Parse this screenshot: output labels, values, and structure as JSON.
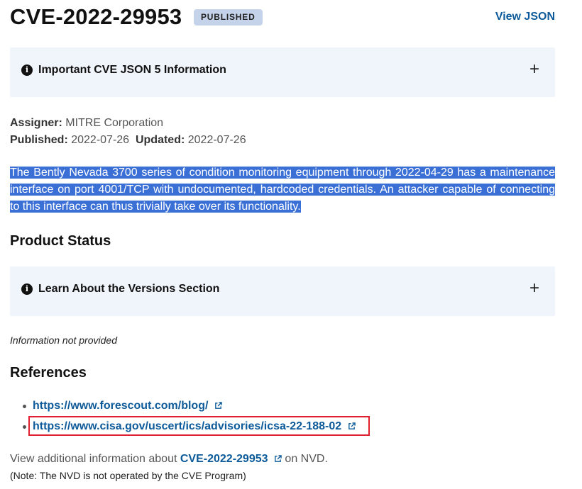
{
  "header": {
    "cve_id": "CVE-2022-29953",
    "status_badge": "PUBLISHED",
    "view_json": "View JSON"
  },
  "accordions": [
    {
      "label": "Important CVE JSON 5 Information",
      "expand_symbol": "+"
    },
    {
      "label": "Learn About the Versions Section",
      "expand_symbol": "+"
    }
  ],
  "meta": {
    "assigner_label": "Assigner:",
    "assigner_value": "MITRE Corporation",
    "published_label": "Published:",
    "published_value": "2022-07-26",
    "updated_label": "Updated:",
    "updated_value": "2022-07-26"
  },
  "description": "The Bently Nevada 3700 series of condition monitoring equipment through 2022-04-29 has a maintenance interface on port 4001/TCP with undocumented, hardcoded credentials. An attacker capable of connecting to this interface can thus trivially take over its functionality.",
  "product_status": {
    "heading": "Product Status",
    "info_text": "Information not provided"
  },
  "references": {
    "heading": "References",
    "links": [
      "https://www.forescout.com/blog/",
      "https://www.cisa.gov/uscert/ics/advisories/icsa-22-188-02"
    ]
  },
  "nvd": {
    "prefix": "View additional information about",
    "link": "CVE-2022-29953",
    "suffix": "on NVD.",
    "note": "(Note: The NVD is not operated by the CVE Program)"
  },
  "colors": {
    "link": "#0c5a99",
    "badge_bg": "#c5d3ea",
    "accordion_bg": "#f0f5fb",
    "selection": "#3a6fd6",
    "highlight_border": "#e0202e"
  },
  "icons": [
    "info-icon",
    "plus-icon",
    "external-link-icon"
  ]
}
